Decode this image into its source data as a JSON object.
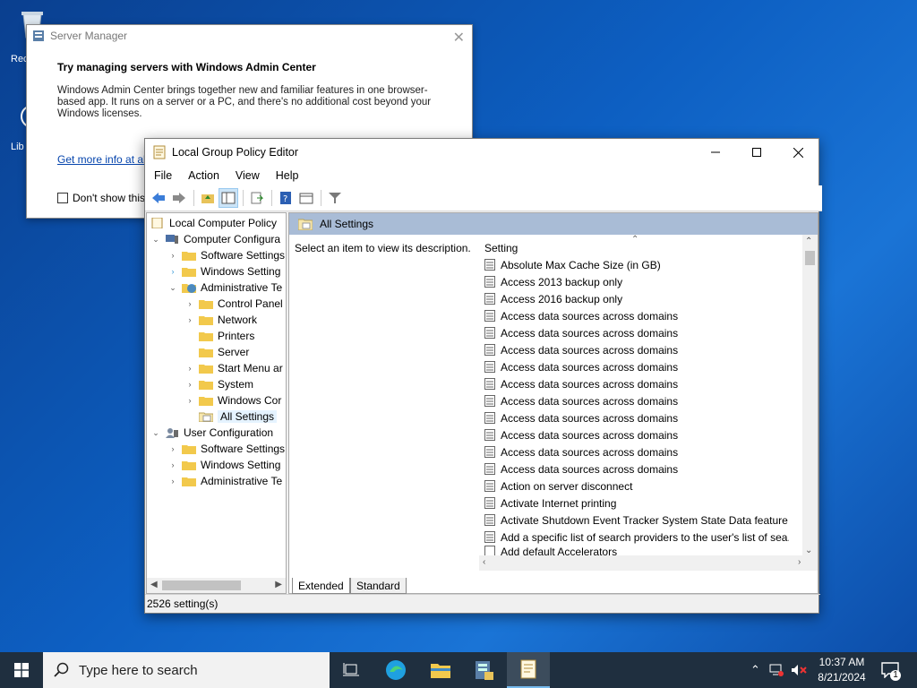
{
  "desktop": {
    "icons": [
      {
        "label": "Rec"
      },
      {
        "label": "Lib"
      }
    ]
  },
  "server_manager": {
    "title": "Server Manager",
    "heading": "Try managing servers with Windows Admin Center",
    "body": "Windows Admin Center brings together new and familiar features in one browser-based app. It runs on a server or a PC, and there's no additional cost beyond your Windows licenses.",
    "link": "Get more info at aka",
    "checkbox_label": "Don't show this m"
  },
  "gpe": {
    "title": "Local Group Policy Editor",
    "menu": [
      "File",
      "Action",
      "View",
      "Help"
    ],
    "tree": [
      {
        "label": "Local Computer Policy"
      },
      {
        "label": "Computer Configura"
      },
      {
        "label": "Software Settings"
      },
      {
        "label": "Windows Setting"
      },
      {
        "label": "Administrative Te"
      },
      {
        "label": "Control Panel"
      },
      {
        "label": "Network"
      },
      {
        "label": "Printers"
      },
      {
        "label": "Server"
      },
      {
        "label": "Start Menu ar"
      },
      {
        "label": "System"
      },
      {
        "label": "Windows Cor"
      },
      {
        "label": "All Settings"
      },
      {
        "label": "User Configuration"
      },
      {
        "label": "Software Settings"
      },
      {
        "label": "Windows Setting"
      },
      {
        "label": "Administrative Te"
      }
    ],
    "pane_title": "All Settings",
    "description": "Select an item to view its description.",
    "column_header": "Setting",
    "settings": [
      "Absolute Max Cache Size (in GB)",
      "Access 2013 backup only",
      "Access 2016 backup only",
      "Access data sources across domains",
      "Access data sources across domains",
      "Access data sources across domains",
      "Access data sources across domains",
      "Access data sources across domains",
      "Access data sources across domains",
      "Access data sources across domains",
      "Access data sources across domains",
      "Access data sources across domains",
      "Access data sources across domains",
      "Action on server disconnect",
      "Activate Internet printing",
      "Activate Shutdown Event Tracker System State Data feature",
      "Add a specific list of search providers to the user's list of sea...",
      "Add default Accelerators"
    ],
    "tabs": [
      "Extended",
      "Standard"
    ],
    "status": "2526 setting(s)"
  },
  "taskbar": {
    "search_placeholder": "Type here to search",
    "time": "10:37 AM",
    "date": "8/21/2024",
    "notification_count": "1"
  }
}
